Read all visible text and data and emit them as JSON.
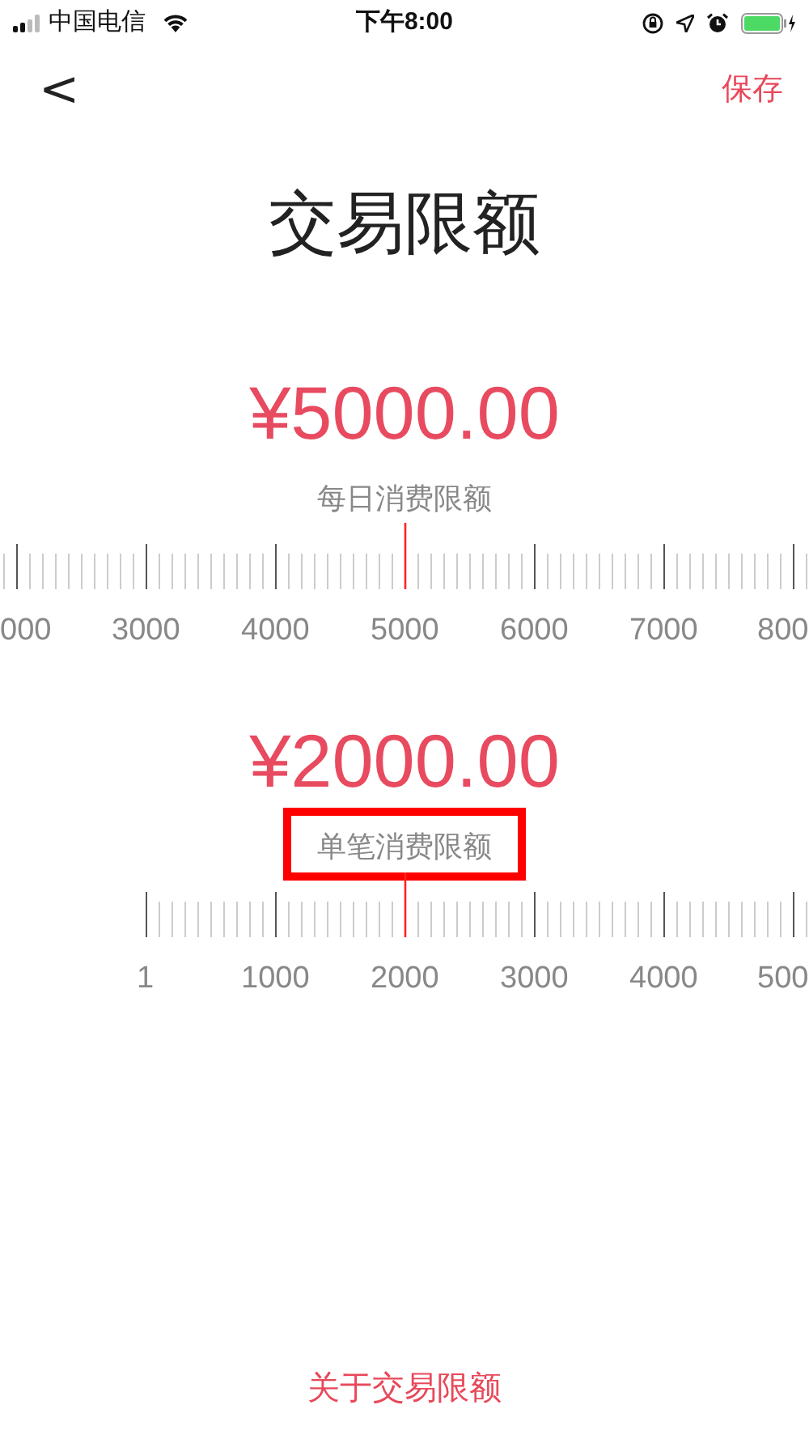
{
  "status_bar": {
    "carrier": "中国电信",
    "time": "下午8:00"
  },
  "nav": {
    "back": "<",
    "save": "保存"
  },
  "title": "交易限额",
  "limits": [
    {
      "amount": "¥5000.00",
      "label": "每日消费限额",
      "highlighted": false,
      "ruler": {
        "kind": "continuous",
        "labels": [
          {
            "text": "000",
            "selected": false
          },
          {
            "text": "3000",
            "selected": false
          },
          {
            "text": "4000",
            "selected": false
          },
          {
            "text": "5000",
            "selected": true
          },
          {
            "text": "6000",
            "selected": false
          },
          {
            "text": "7000",
            "selected": false
          },
          {
            "text": "800",
            "selected": false
          }
        ]
      }
    },
    {
      "amount": "¥2000.00",
      "label": "单笔消费限额",
      "highlighted": true,
      "ruler": {
        "kind": "bounded",
        "labels": [
          {
            "text": "1",
            "selected": false
          },
          {
            "text": "1000",
            "selected": false
          },
          {
            "text": "2000",
            "selected": true
          },
          {
            "text": "3000",
            "selected": false
          },
          {
            "text": "4000",
            "selected": false
          },
          {
            "text": "500",
            "selected": false
          }
        ]
      }
    }
  ],
  "footer_link": "关于交易限额"
}
